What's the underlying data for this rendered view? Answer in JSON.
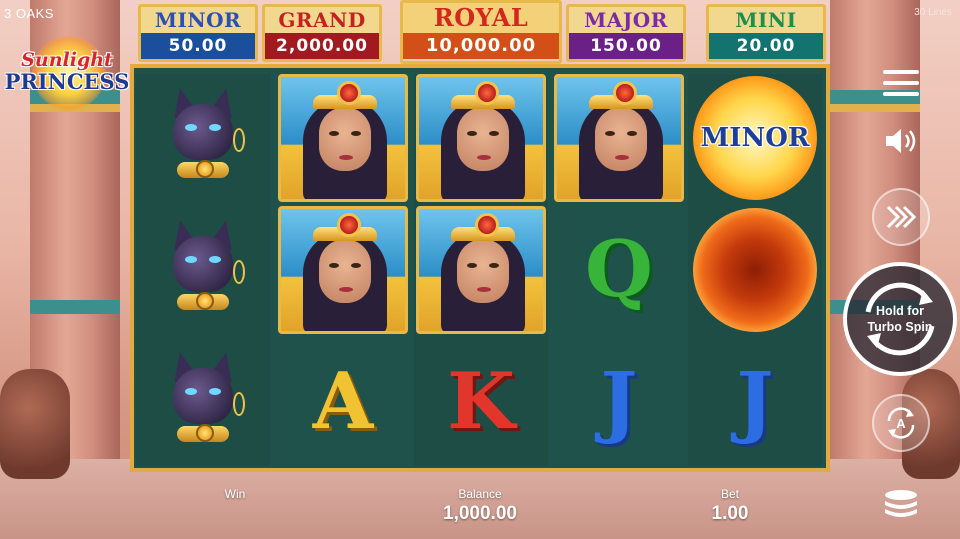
{
  "header": {
    "brand": "3 OAKS",
    "lines": "30 Lines",
    "logo_line1": "Sunlight",
    "logo_line2": "PRINCESS"
  },
  "jackpots": [
    {
      "name": "MINOR",
      "value": "50.00"
    },
    {
      "name": "GRAND",
      "value": "2,000.00"
    },
    {
      "name": "ROYAL",
      "value": "10,000.00"
    },
    {
      "name": "MAJOR",
      "value": "150.00"
    },
    {
      "name": "MINI",
      "value": "20.00"
    }
  ],
  "reels": [
    [
      "cat",
      "cat",
      "cat"
    ],
    [
      "princess",
      "princess",
      "A"
    ],
    [
      "princess",
      "princess",
      "K"
    ],
    [
      "princess",
      "Q",
      "J"
    ],
    [
      "sun-minor",
      "sun-fire",
      "J"
    ]
  ],
  "symbols": {
    "q": "Q",
    "a": "A",
    "k": "K",
    "j1": "J",
    "j2": "J",
    "sun_label": "MINOR"
  },
  "controls": {
    "spin_label": "Hold for\nTurbo Spin",
    "auto_letter": "A",
    "icons": [
      "menu-icon",
      "sound-icon",
      "fast-forward-icon",
      "spin-icon",
      "autoplay-icon",
      "coins-icon"
    ]
  },
  "footer": {
    "win_label": "Win",
    "win_value": "",
    "balance_label": "Balance",
    "balance_value": "1,000.00",
    "bet_label": "Bet",
    "bet_value": "1.00"
  },
  "colors": {
    "frame_gold": "#e3ab3f",
    "reel_bg": "#1f524a",
    "minor_blue": "#1c4e9e",
    "grand_red": "#a11a20",
    "royal_orange": "#d24f17",
    "major_purple": "#6b2088",
    "mini_teal": "#13746f"
  }
}
